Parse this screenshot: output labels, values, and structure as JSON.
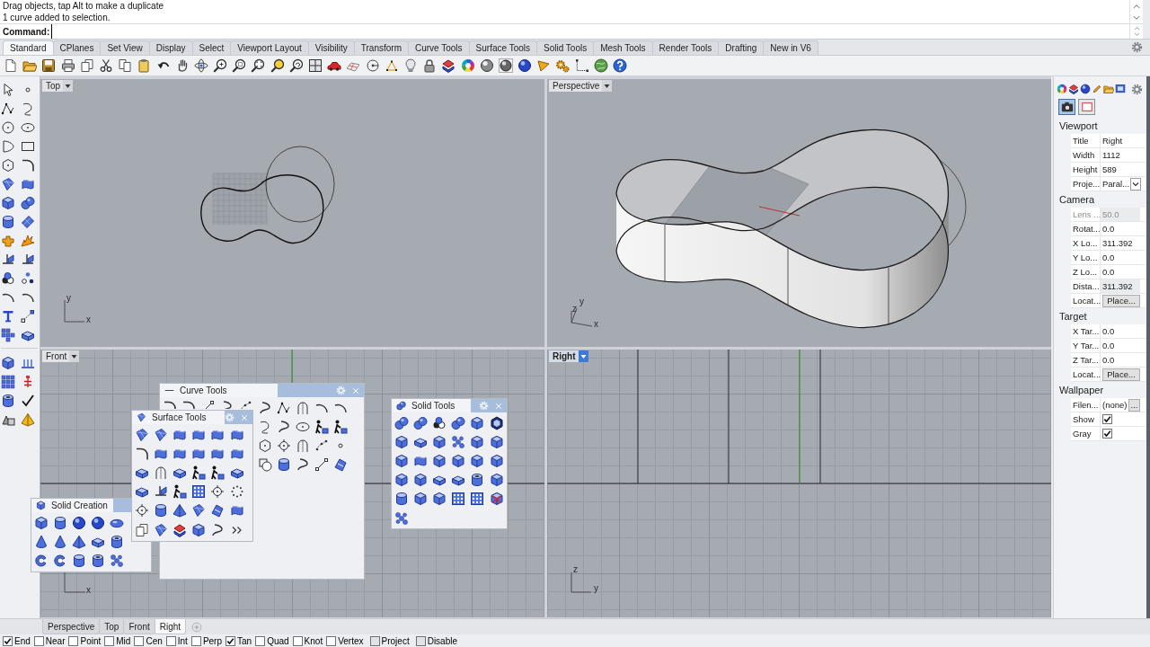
{
  "command_history": [
    "Drag objects, tap Alt to make a duplicate",
    "1 curve added to selection."
  ],
  "command_prompt": "Command:",
  "toolbar_tabs": [
    {
      "label": "Standard",
      "selected": true
    },
    {
      "label": "CPlanes",
      "selected": false
    },
    {
      "label": "Set View",
      "selected": false
    },
    {
      "label": "Display",
      "selected": false
    },
    {
      "label": "Select",
      "selected": false
    },
    {
      "label": "Viewport Layout",
      "selected": false
    },
    {
      "label": "Visibility",
      "selected": false
    },
    {
      "label": "Transform",
      "selected": false
    },
    {
      "label": "Curve Tools",
      "selected": false
    },
    {
      "label": "Surface Tools",
      "selected": false
    },
    {
      "label": "Solid Tools",
      "selected": false
    },
    {
      "label": "Mesh Tools",
      "selected": false
    },
    {
      "label": "Render Tools",
      "selected": false
    },
    {
      "label": "Drafting",
      "selected": false
    },
    {
      "label": "New in V6",
      "selected": false
    }
  ],
  "viewports": [
    {
      "title": "Top",
      "active": false,
      "grid": false,
      "axis_labels": [
        "y",
        "x"
      ]
    },
    {
      "title": "Perspective",
      "active": false,
      "grid": false,
      "axis_labels": [
        "y",
        "z",
        "x"
      ]
    },
    {
      "title": "Front",
      "active": false,
      "grid": true,
      "axis_labels": [
        "x"
      ]
    },
    {
      "title": "Right",
      "active": true,
      "grid": true,
      "axis_labels": [
        "z",
        "y"
      ]
    }
  ],
  "floating_toolbars": [
    {
      "title": "Curve Tools"
    },
    {
      "title": "Surface Tools"
    },
    {
      "title": "Solid Tools"
    },
    {
      "title": "Solid Creation"
    }
  ],
  "properties": {
    "page_tabs": [
      {
        "selected": true
      },
      {
        "selected": false
      }
    ],
    "sections": [
      {
        "title": "Viewport",
        "rows": [
          {
            "kind": "text",
            "label": "Title",
            "value": "Right",
            "disabled": false
          },
          {
            "kind": "text",
            "label": "Width",
            "value": "1112",
            "disabled": false
          },
          {
            "kind": "text",
            "label": "Height",
            "value": "589",
            "disabled": false
          },
          {
            "kind": "dropdown",
            "label": "Proje...",
            "value": "Paral...",
            "disabled": false
          }
        ]
      },
      {
        "title": "Camera",
        "rows": [
          {
            "kind": "readonly",
            "label": "Lens ...",
            "value": "50.0",
            "disabled": true
          },
          {
            "kind": "text",
            "label": "Rotat...",
            "value": "0.0",
            "disabled": false
          },
          {
            "kind": "text",
            "label": "X Lo...",
            "value": "311.392",
            "disabled": false
          },
          {
            "kind": "text",
            "label": "Y Lo...",
            "value": "0.0",
            "disabled": false
          },
          {
            "kind": "text",
            "label": "Z Lo...",
            "value": "0.0",
            "disabled": false
          },
          {
            "kind": "readonly",
            "label": "Dista...",
            "value": "311.392",
            "disabled": false
          },
          {
            "kind": "button",
            "label": "Locat...",
            "value": "Place...",
            "disabled": false
          }
        ]
      },
      {
        "title": "Target",
        "rows": [
          {
            "kind": "text",
            "label": "X Tar...",
            "value": "0.0",
            "disabled": false
          },
          {
            "kind": "text",
            "label": "Y Tar...",
            "value": "0.0",
            "disabled": false
          },
          {
            "kind": "text",
            "label": "Z Tar...",
            "value": "0.0",
            "disabled": false
          },
          {
            "kind": "button",
            "label": "Locat...",
            "value": "Place...",
            "disabled": false
          }
        ]
      },
      {
        "title": "Wallpaper",
        "rows": [
          {
            "kind": "file",
            "label": "Filen...",
            "value": "(none)",
            "button": "...",
            "disabled": false
          },
          {
            "kind": "checkbox",
            "label": "Show",
            "checked": true,
            "disabled": false
          },
          {
            "kind": "checkbox",
            "label": "Gray",
            "checked": true,
            "disabled": false
          }
        ]
      }
    ]
  },
  "viewport_tabs": [
    {
      "label": "Perspective",
      "selected": false
    },
    {
      "label": "Top",
      "selected": false
    },
    {
      "label": "Front",
      "selected": false
    },
    {
      "label": "Right",
      "selected": true
    }
  ],
  "osnaps": [
    {
      "kind": "snap",
      "label": "End",
      "checked": true
    },
    {
      "kind": "snap",
      "label": "Near",
      "checked": false
    },
    {
      "kind": "snap",
      "label": "Point",
      "checked": false
    },
    {
      "kind": "snap",
      "label": "Mid",
      "checked": false
    },
    {
      "kind": "snap",
      "label": "Cen",
      "checked": false
    },
    {
      "kind": "snap",
      "label": "Int",
      "checked": false
    },
    {
      "kind": "snap",
      "label": "Perp",
      "checked": false
    },
    {
      "kind": "snap",
      "label": "Tan",
      "checked": true
    },
    {
      "kind": "snap",
      "label": "Quad",
      "checked": false
    },
    {
      "kind": "snap",
      "label": "Knot",
      "checked": false
    },
    {
      "kind": "snap",
      "label": "Vertex",
      "checked": false
    },
    {
      "kind": "mode",
      "label": "Project",
      "checked": false
    },
    {
      "kind": "mode",
      "label": "Disable",
      "checked": false
    }
  ]
}
